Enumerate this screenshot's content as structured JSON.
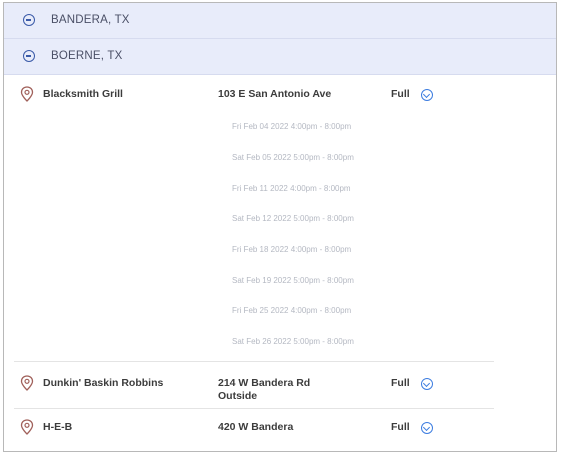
{
  "cities": [
    {
      "label": "BANDERA, TX",
      "icon": "collapse-circle-icon"
    },
    {
      "label": "BOERNE, TX",
      "icon": "collapse-circle-icon"
    }
  ],
  "locations": [
    {
      "name": "Blacksmith Grill",
      "address": "103 E San Antonio Ave",
      "status": "Full",
      "times": [
        "Fri Feb 04 2022 4:00pm - 8:00pm",
        "Sat Feb 05 2022 5:00pm - 8:00pm",
        "Fri Feb 11 2022 4:00pm - 8:00pm",
        "Sat Feb 12 2022 5:00pm - 8:00pm",
        "Fri Feb 18 2022 4:00pm - 8:00pm",
        "Sat Feb 19 2022 5:00pm - 8:00pm",
        "Fri Feb 25 2022 4:00pm - 8:00pm",
        "Sat Feb 26 2022 5:00pm - 8:00pm"
      ]
    },
    {
      "name": "Dunkin' Baskin Robbins",
      "address": "214 W Bandera Rd",
      "address2": "Outside",
      "status": "Full"
    },
    {
      "name": "H-E-B",
      "address": "420 W Bandera",
      "status": "Full"
    }
  ],
  "colors": {
    "city_bg": "#e8ecfa",
    "city_icon": "#3a5aa8",
    "expand_icon": "#3d7de0",
    "pin": "#a0605a"
  }
}
